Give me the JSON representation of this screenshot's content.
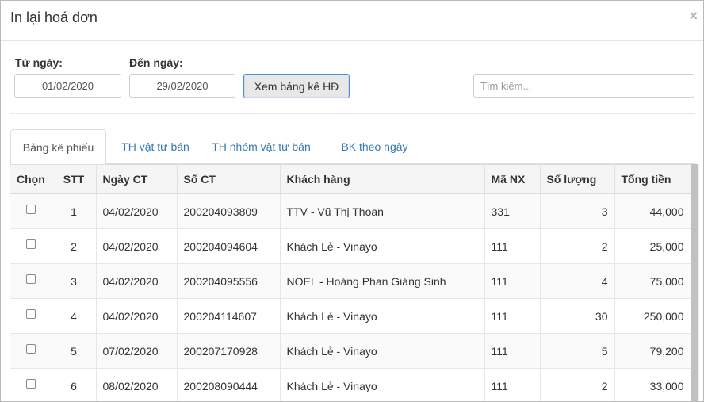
{
  "modal": {
    "title": "In lại hoá đơn",
    "close": "×"
  },
  "filters": {
    "from_label": "Từ ngày:",
    "from_value": "01/02/2020",
    "to_label": "Đến ngày:",
    "to_value": "29/02/2020",
    "view_button": "Xem bảng kê HĐ",
    "search_placeholder": "Tìm kiếm..."
  },
  "tabs": [
    {
      "label": "Bảng kê phiếu",
      "active": true
    },
    {
      "label": "TH vật tư bán",
      "active": false
    },
    {
      "label": "TH nhóm vật tư bán",
      "active": false
    },
    {
      "label": "BK theo ngày",
      "active": false
    }
  ],
  "table": {
    "headers": [
      "Chọn",
      "STT",
      "Ngày CT",
      "Số CT",
      "Khách hàng",
      "Mã NX",
      "Số lượng",
      "Tổng tiền"
    ],
    "rows": [
      {
        "stt": "1",
        "date": "04/02/2020",
        "so_ct": "200204093809",
        "customer": "TTV - Vũ Thị Thoan",
        "ma_nx": "331",
        "qty": "3",
        "total": "44,000"
      },
      {
        "stt": "2",
        "date": "04/02/2020",
        "so_ct": "200204094604",
        "customer": "Khách Lẻ - Vinayo",
        "ma_nx": "111",
        "qty": "2",
        "total": "25,000"
      },
      {
        "stt": "3",
        "date": "04/02/2020",
        "so_ct": "200204095556",
        "customer": "NOEL - Hoàng Phan Giáng Sinh",
        "ma_nx": "111",
        "qty": "4",
        "total": "75,000"
      },
      {
        "stt": "4",
        "date": "04/02/2020",
        "so_ct": "200204114607",
        "customer": "Khách Lẻ - Vinayo",
        "ma_nx": "111",
        "qty": "30",
        "total": "250,000"
      },
      {
        "stt": "5",
        "date": "07/02/2020",
        "so_ct": "200207170928",
        "customer": "Khách Lẻ - Vinayo",
        "ma_nx": "111",
        "qty": "5",
        "total": "79,200"
      },
      {
        "stt": "6",
        "date": "08/02/2020",
        "so_ct": "200208090444",
        "customer": "Khách Lẻ - Vinayo",
        "ma_nx": "111",
        "qty": "2",
        "total": "33,000"
      }
    ]
  }
}
